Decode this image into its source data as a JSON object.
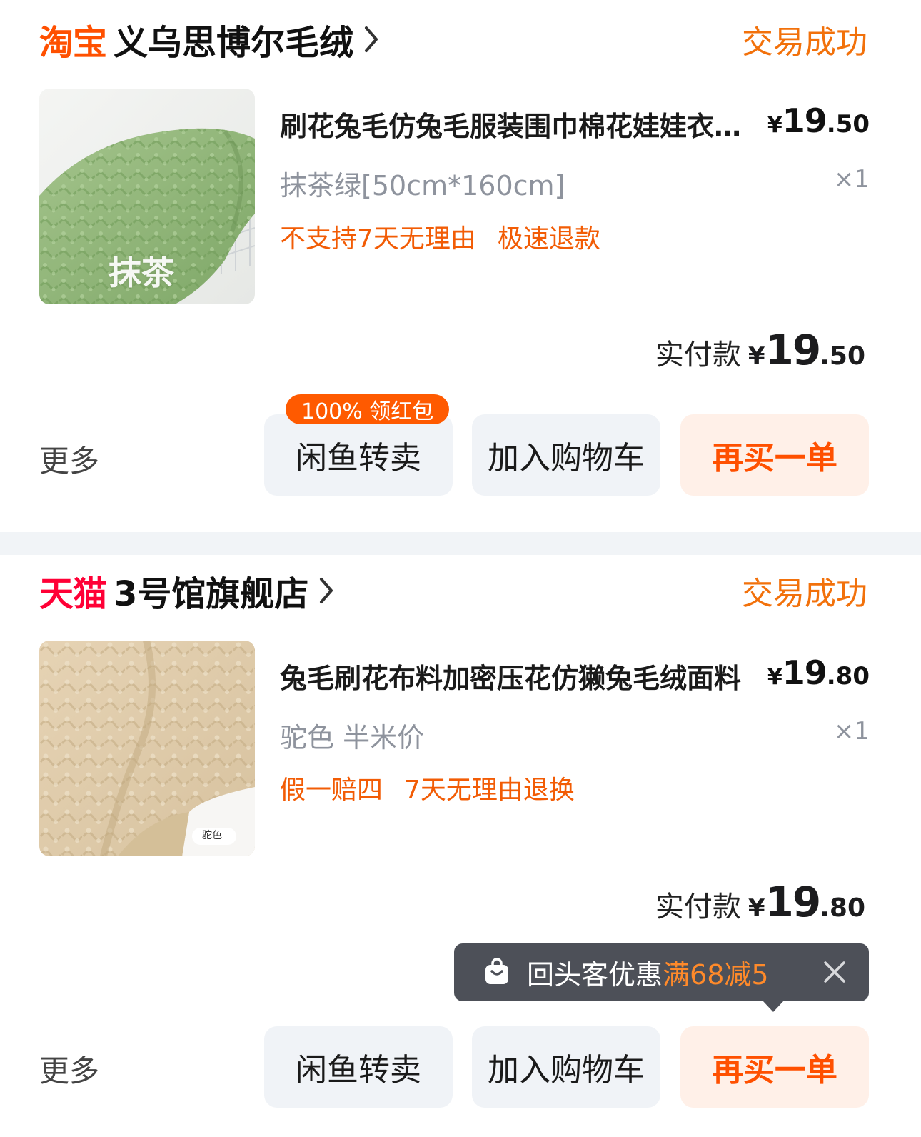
{
  "colors": {
    "orange": "#ff5000",
    "tmall_red": "#ff0036",
    "status_orange": "#f2710b",
    "tag_orange": "#f25c05",
    "badge_orange": "#ff5a00",
    "gray_text": "#8e939d"
  },
  "orders": [
    {
      "platform": "淘宝",
      "shop_name": "义乌思博尔毛绒",
      "status": "交易成功",
      "thumbnail_label": "抹茶",
      "thumbnail_icon": "green-plush-fabric-image",
      "title": "刷花兔毛仿兔毛服装围巾棉花娃娃衣服面料",
      "price_symbol": "¥",
      "price_int": "19",
      "price_dec": ".50",
      "spec": "抹茶绿[50cm*160cm]",
      "qty": "×1",
      "tags": [
        "不支持7天无理由",
        "极速退款"
      ],
      "paid_label": "实付款",
      "paid_symbol": "¥",
      "paid_int": "19",
      "paid_dec": ".50",
      "more": "更多",
      "badge": "100% 领红包",
      "buttons": {
        "resell": "闲鱼转卖",
        "add_cart": "加入购物车",
        "rebuy": "再买一单"
      }
    },
    {
      "platform": "天猫",
      "shop_name": "3号馆旗舰店",
      "status": "交易成功",
      "thumbnail_label": "驼色",
      "thumbnail_icon": "camel-plush-fabric-image",
      "title": "兔毛刷花布料加密压花仿獭兔毛绒面料",
      "price_symbol": "¥",
      "price_int": "19",
      "price_dec": ".80",
      "spec": "驼色 半米价",
      "qty": "×1",
      "tags": [
        "假一赔四",
        "7天无理由退换"
      ],
      "paid_label": "实付款",
      "paid_symbol": "¥",
      "paid_int": "19",
      "paid_dec": ".80",
      "more": "更多",
      "buttons": {
        "resell": "闲鱼转卖",
        "add_cart": "加入购物车",
        "rebuy": "再买一单"
      }
    }
  ],
  "tooltip": {
    "text": "回头客优惠",
    "highlight": "满68减5",
    "icon": "shopping-bag-icon",
    "close_icon": "close-icon"
  }
}
